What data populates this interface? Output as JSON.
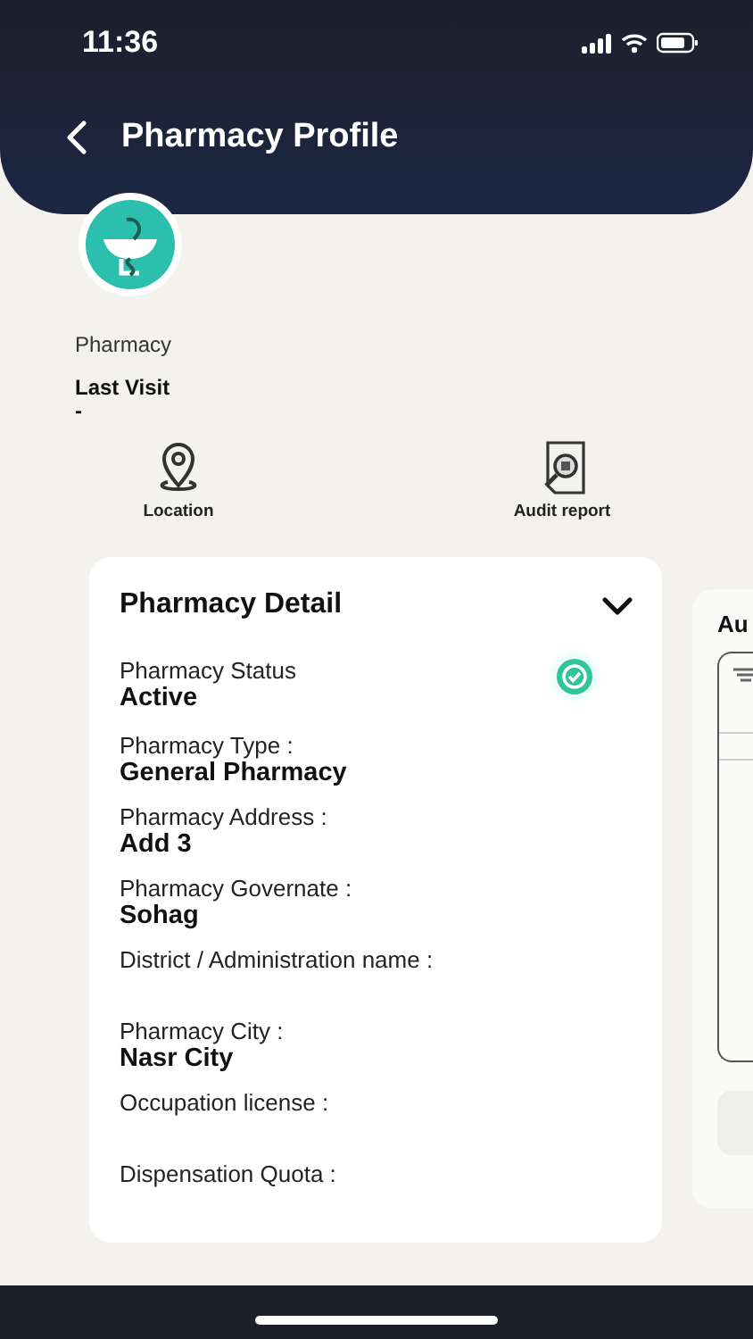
{
  "status_bar": {
    "time": "11:36"
  },
  "header": {
    "title": "Pharmacy Profile"
  },
  "profile": {
    "name": "Pharmacy",
    "last_visit_label": "Last Visit",
    "last_visit_value": "-"
  },
  "actions": [
    {
      "kind": "location",
      "label": "Location"
    },
    {
      "kind": "audit",
      "label": "Audit report"
    }
  ],
  "detail_card": {
    "title": "Pharmacy Detail",
    "expanded": true,
    "fields": [
      {
        "label": "Pharmacy Status",
        "value": "Active",
        "verified": true
      },
      {
        "label": "Pharmacy Type :",
        "value": "General Pharmacy"
      },
      {
        "label": "Pharmacy Address :",
        "value": "Add 3"
      },
      {
        "label": "Pharmacy Governate :",
        "value": "Sohag"
      },
      {
        "label": "District / Administration name :"
      },
      {
        "label": "Pharmacy City :",
        "value": "Nasr City"
      },
      {
        "label": "Occupation license :"
      },
      {
        "label": "Dispensation Quota :"
      }
    ]
  },
  "next_card": {
    "title": "Au"
  }
}
